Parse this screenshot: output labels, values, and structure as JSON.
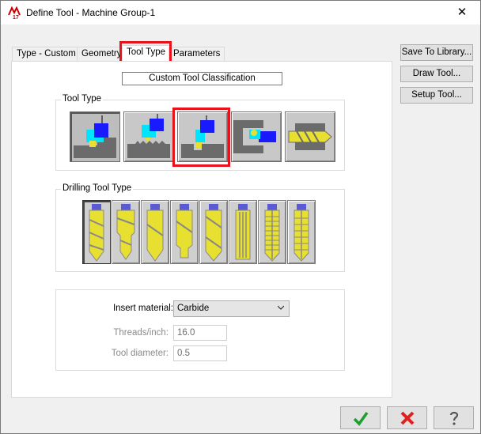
{
  "window": {
    "title": "Define Tool - Machine Group-1",
    "app_icon": "mastercam-17-icon",
    "close_glyph": "✕"
  },
  "tabs": [
    {
      "label": "Type - Custom",
      "active": false
    },
    {
      "label": "Geometry",
      "active": false
    },
    {
      "label": "Tool Type",
      "active": true
    },
    {
      "label": "Parameters",
      "active": false
    }
  ],
  "classification": "Custom Tool Classification",
  "tool_type": {
    "label": "Tool Type",
    "items": [
      {
        "icon": "general-turning-tool-icon",
        "pressed": true
      },
      {
        "icon": "threading-tool-icon",
        "pressed": false
      },
      {
        "icon": "grooving-tool-icon",
        "pressed": false,
        "highlighted": true
      },
      {
        "icon": "boring-bar-tool-icon",
        "pressed": false
      },
      {
        "icon": "drilling-tool-icon",
        "pressed": false
      }
    ]
  },
  "drilling_tool_type": {
    "label": "Drilling Tool Type",
    "items": [
      {
        "icon": "drill-icon",
        "pressed": true
      },
      {
        "icon": "step-drill-icon",
        "pressed": false
      },
      {
        "icon": "spot-drill-icon",
        "pressed": false
      },
      {
        "icon": "center-drill-icon",
        "pressed": false
      },
      {
        "icon": "countersink-icon",
        "pressed": false
      },
      {
        "icon": "reamer-icon",
        "pressed": false
      },
      {
        "icon": "tap-icon",
        "pressed": false
      },
      {
        "icon": "thread-mill-icon",
        "pressed": false
      }
    ]
  },
  "fields": {
    "insert_material_label": "Insert material:",
    "insert_material_value": "Carbide",
    "threads_label": "Threads/inch:",
    "threads_value": "16.0",
    "diameter_label": "Tool diameter:",
    "diameter_value": "0.5"
  },
  "side_buttons": {
    "save_to_library": "Save To Library...",
    "draw_tool": "Draw Tool...",
    "setup_tool": "Setup Tool..."
  },
  "bottom_buttons": {
    "ok_icon": "green-check-icon",
    "cancel_icon": "red-x-icon",
    "help_icon": "question-mark-icon"
  },
  "colors": {
    "highlight_red": "#e8121c",
    "accent_blue": "#1a1aff",
    "accent_cyan": "#00e5ff",
    "insert_yellow": "#e8e030",
    "tool_gray": "#6b6b6b"
  }
}
